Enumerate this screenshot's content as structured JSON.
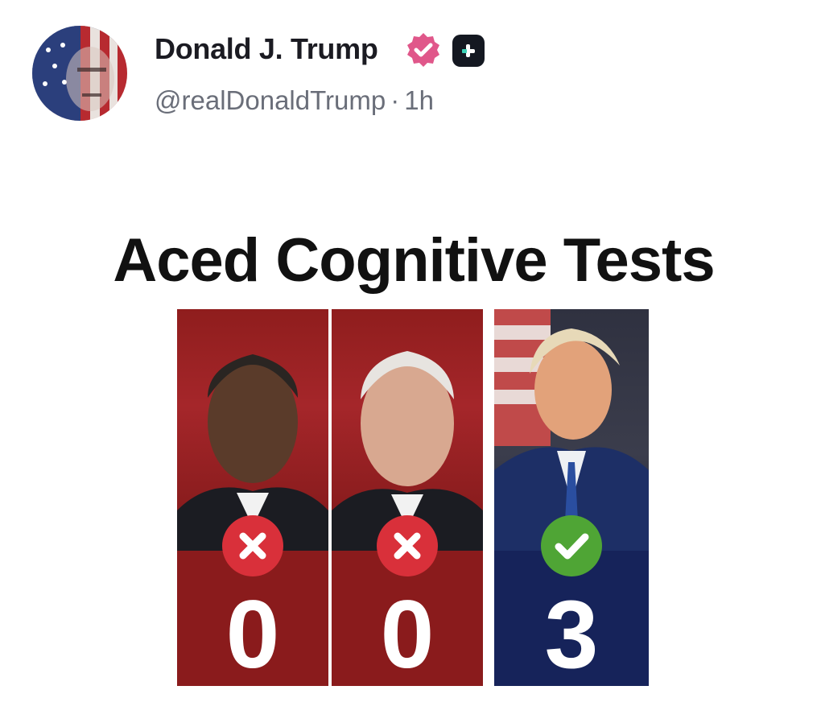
{
  "post": {
    "display_name": "Donald J. Trump",
    "handle": "@realDonaldTrump",
    "separator": "·",
    "timestamp": "1h",
    "icons": {
      "verified": "verified-badge-icon",
      "subscription": "plus-badge-icon"
    },
    "colors": {
      "verified_badge": "#e0578a",
      "plus_badge": "#141821",
      "name": "#1b1b22",
      "meta": "#6a6e79"
    }
  },
  "image": {
    "title": "Aced Cognitive Tests",
    "panels": [
      {
        "score": "0",
        "mark": "x-mark-icon",
        "color": "#8a1b1c"
      },
      {
        "score": "0",
        "mark": "x-mark-icon",
        "color": "#8a1b1c"
      },
      {
        "score": "3",
        "mark": "check-mark-icon",
        "color": "#16235a"
      }
    ]
  }
}
